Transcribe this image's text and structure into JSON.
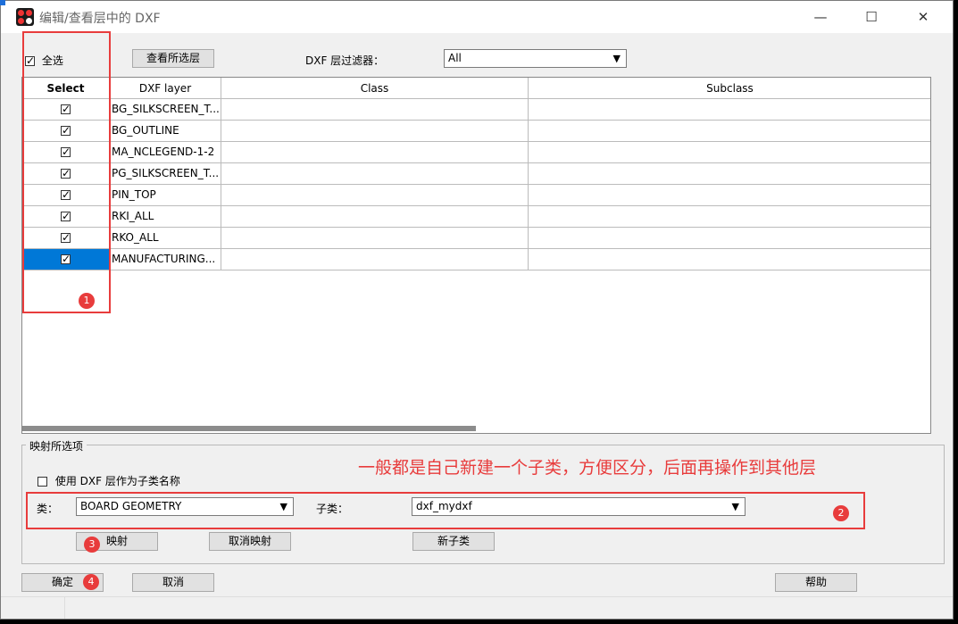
{
  "window": {
    "title": "编辑/查看层中的 DXF",
    "minimize_glyph": "—",
    "maximize_glyph": "☐",
    "close_glyph": "✕"
  },
  "toolbar": {
    "select_all_label": "全选",
    "select_all_checked": true,
    "view_selected_label": "查看所选层",
    "filter_label": "DXF 层过滤器：",
    "filter_value": "All"
  },
  "grid": {
    "headers": [
      "Select",
      "DXF layer",
      "Class",
      "Subclass"
    ],
    "rows": [
      {
        "selected": true,
        "layer": "BG_SILKSCREEN_T...",
        "class": "",
        "subclass": ""
      },
      {
        "selected": true,
        "layer": "BG_OUTLINE",
        "class": "",
        "subclass": ""
      },
      {
        "selected": true,
        "layer": "MA_NCLEGEND-1-2",
        "class": "",
        "subclass": ""
      },
      {
        "selected": true,
        "layer": "PG_SILKSCREEN_T...",
        "class": "",
        "subclass": ""
      },
      {
        "selected": true,
        "layer": "PIN_TOP",
        "class": "",
        "subclass": ""
      },
      {
        "selected": true,
        "layer": "RKI_ALL",
        "class": "",
        "subclass": ""
      },
      {
        "selected": true,
        "layer": "RKO_ALL",
        "class": "",
        "subclass": ""
      },
      {
        "selected": true,
        "layer": "MANUFACTURING...",
        "class": "",
        "subclass": "",
        "highlighted": true
      }
    ]
  },
  "mapping": {
    "group_label": "映射所选项",
    "use_layer_name_label": "使用 DXF 层作为子类名称",
    "class_label": "类：",
    "class_value": "BOARD GEOMETRY",
    "subclass_label": "子类：",
    "subclass_value": "dxf_mydxf",
    "map_button": "映射",
    "unmap_button": "取消映射",
    "new_subclass_button": "新子类"
  },
  "footer": {
    "ok_button": "确定",
    "cancel_button": "取消",
    "help_button": "帮助"
  },
  "annotations": {
    "note": "一般都是自己新建一个子类，方便区分，后面再操作到其他层",
    "badge1": "1",
    "badge2": "2",
    "badge3": "3",
    "badge4": "4"
  },
  "colors": {
    "highlight": "#0078d7",
    "annotation_red": "#e83c3c"
  }
}
